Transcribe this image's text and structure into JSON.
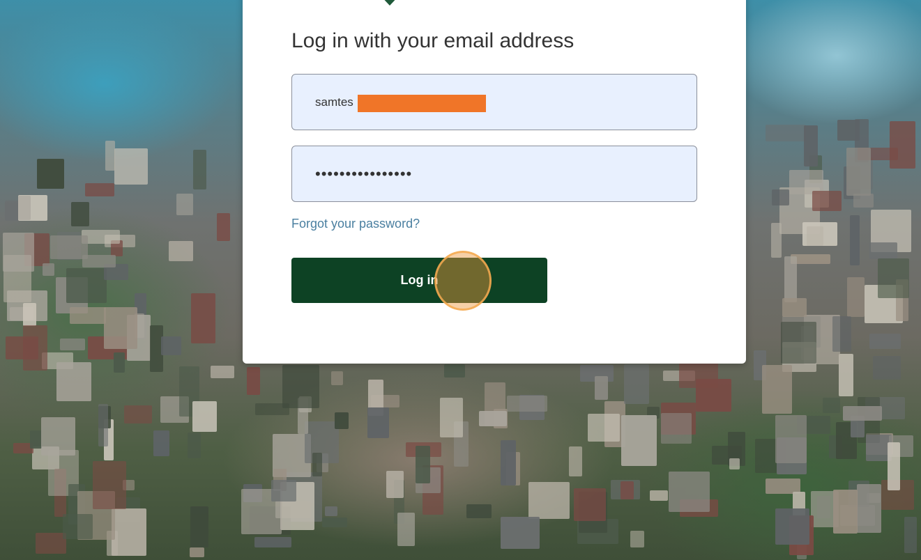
{
  "login": {
    "heading": "Log in with your email address",
    "email_value": "samtes                    m",
    "password_value": "••••••••••••••••",
    "forgot_link": "Forgot your password?",
    "login_button": "Log in"
  },
  "colors": {
    "brand_green": "#0d4224",
    "link_blue": "#4a7fa0",
    "field_bg": "#e8f0fe",
    "redaction": "#f07528",
    "click_marker": "#f4aa50"
  },
  "icons": {
    "logo": "shield-icon"
  }
}
